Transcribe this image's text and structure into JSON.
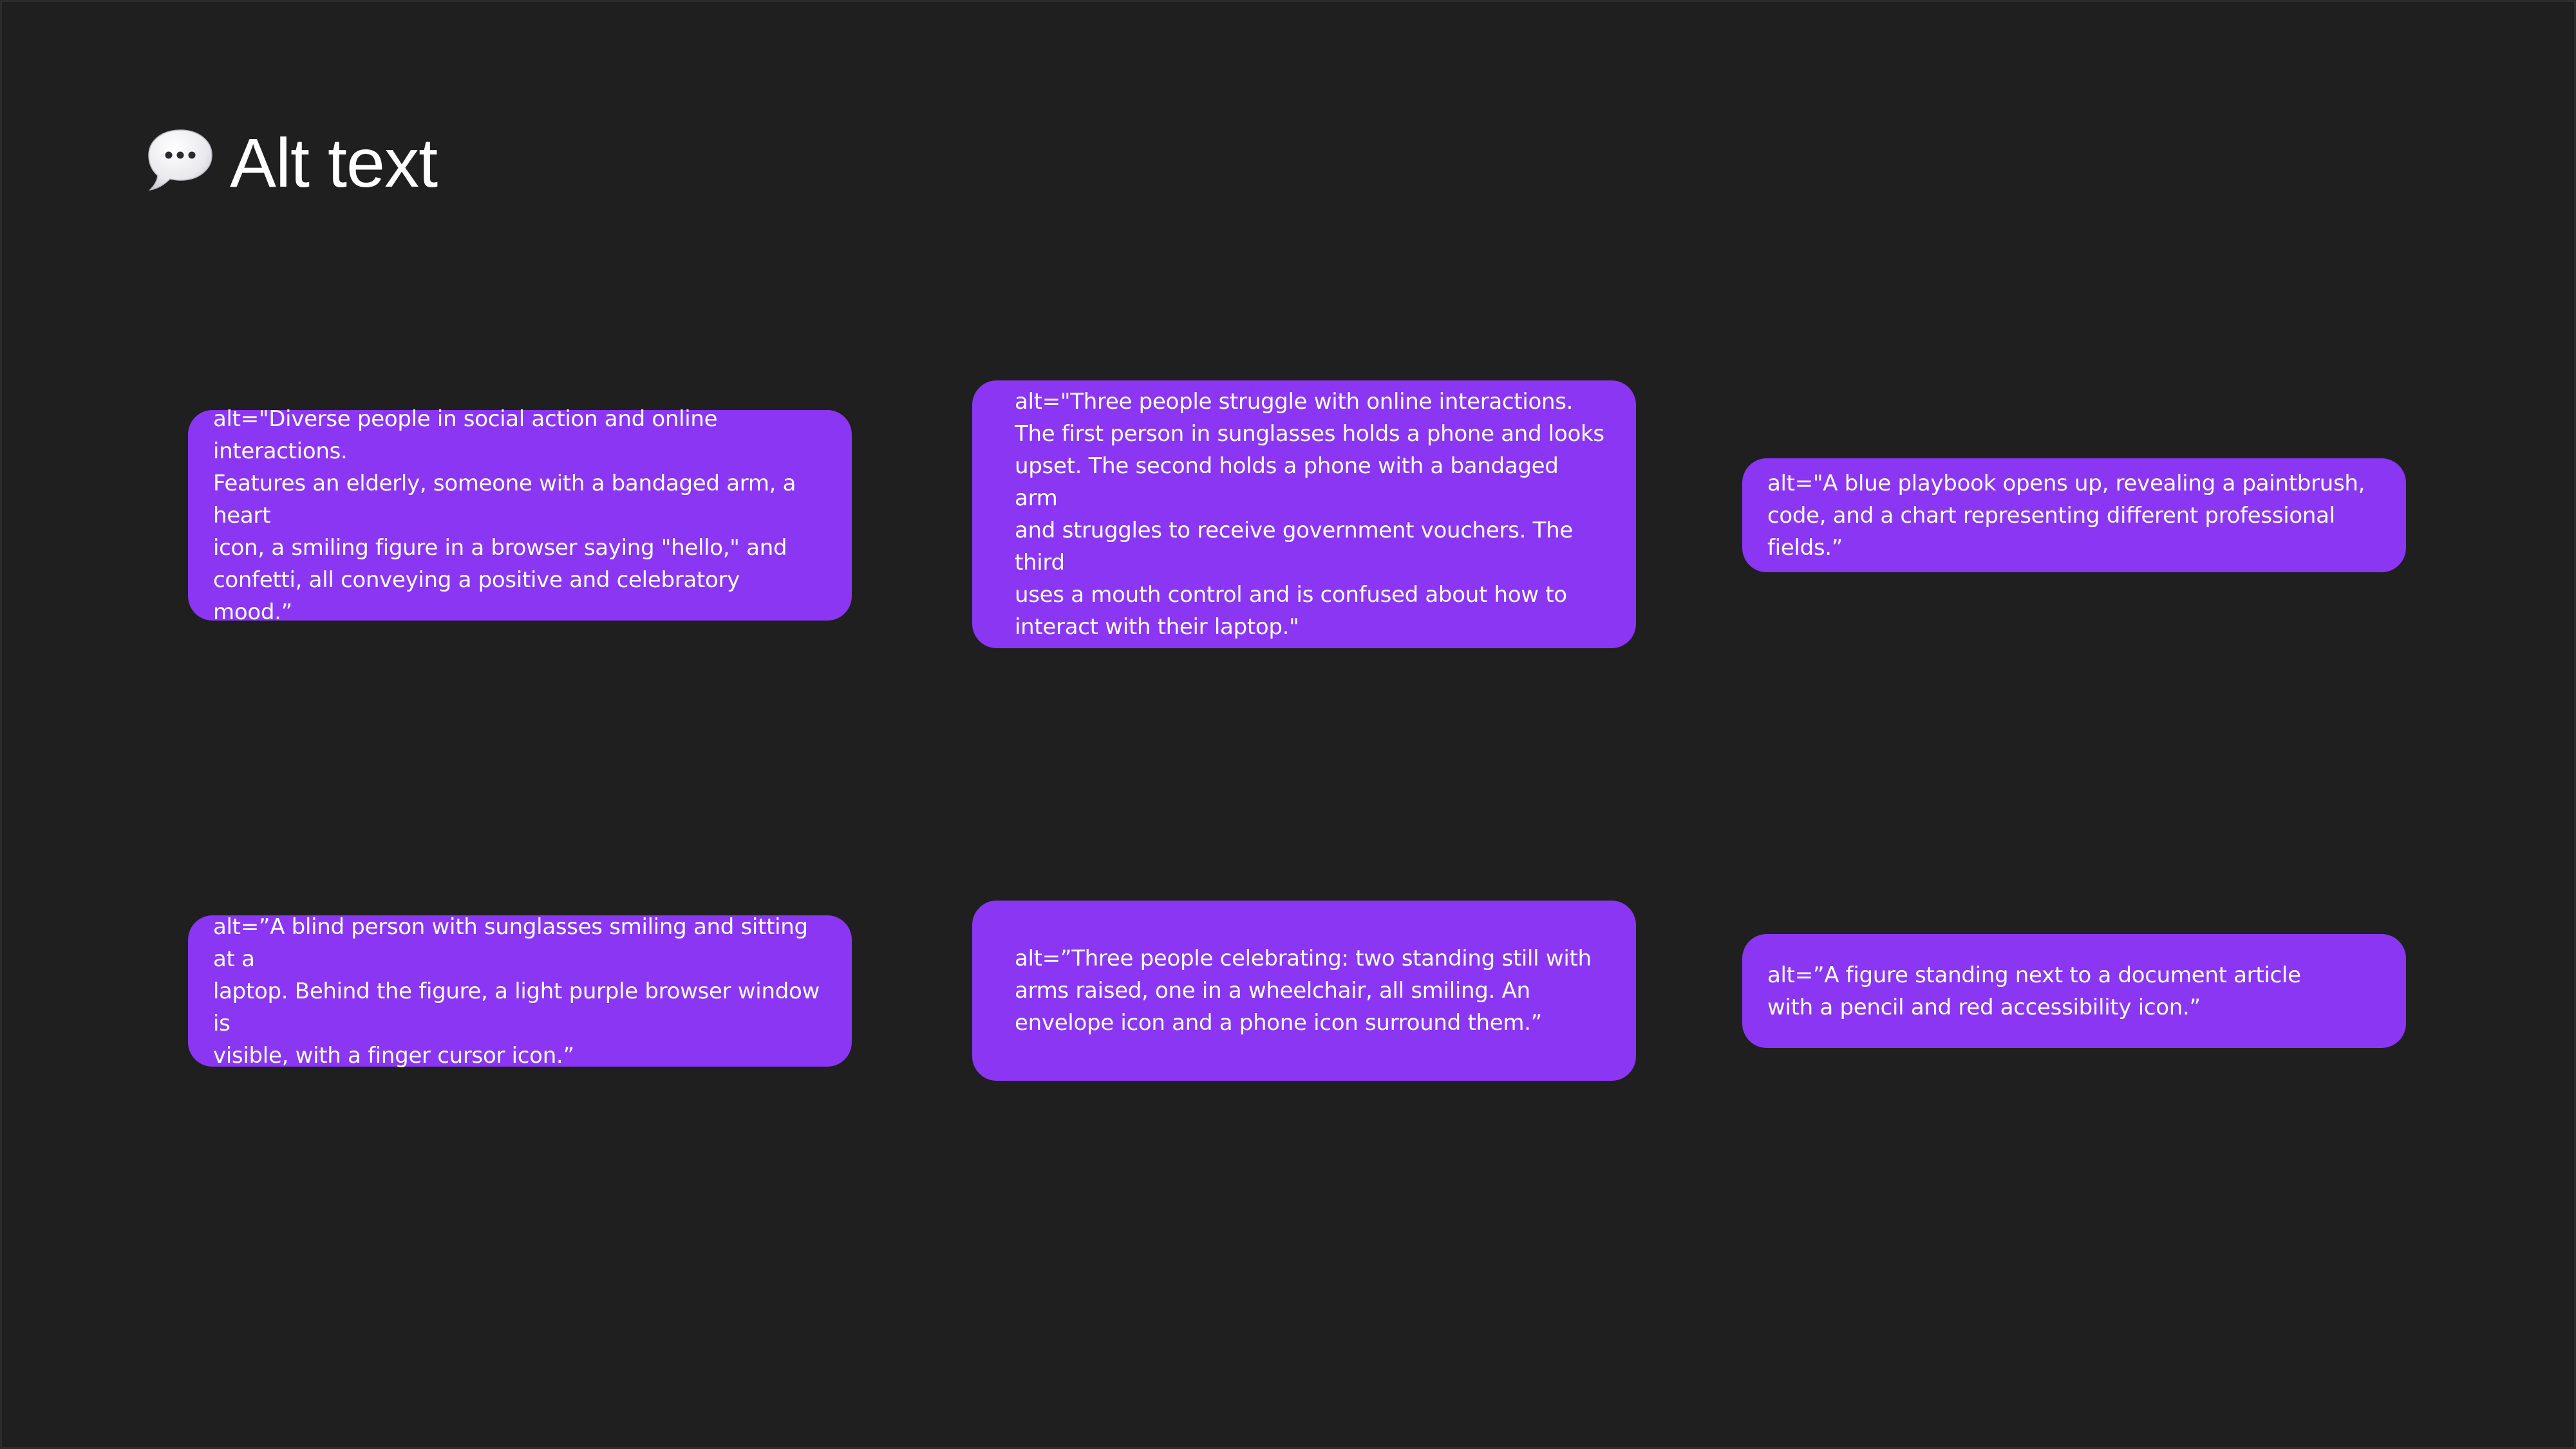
{
  "header": {
    "icon": "speech-bubble-icon",
    "title": "Alt text"
  },
  "colors": {
    "background": "#1f1f1f",
    "card": "#8b36f2",
    "text": "#ffffff"
  },
  "cards": [
    {
      "text": "alt=\"Diverse people in social action and online interactions.\nFeatures an elderly, someone with a bandaged arm, a heart\nicon, a smiling figure in a browser saying \"hello,\" and\nconfetti, all conveying a positive and celebratory mood.”"
    },
    {
      "text": "alt=\"Three people struggle with online interactions.\nThe first person in sunglasses holds a phone and looks\nupset. The second holds a phone with a bandaged arm\nand struggles to receive government vouchers. The third\nuses a mouth control and is confused about how to\ninteract with their laptop.\""
    },
    {
      "text": "alt=\"A blue playbook opens up, revealing a paintbrush,\ncode, and a chart representing different professional fields.”"
    },
    {
      "text": "alt=”A blind person with sunglasses smiling and sitting at a\nlaptop. Behind the figure, a light purple browser window is\nvisible, with a finger cursor icon.”"
    },
    {
      "text": "alt=”Three people celebrating: two standing still with\narms raised, one in a wheelchair, all smiling. An\nenvelope icon and a phone icon surround them.”"
    },
    {
      "text": "alt=”A figure standing next to a document article\nwith a pencil and red accessibility icon.”"
    }
  ]
}
